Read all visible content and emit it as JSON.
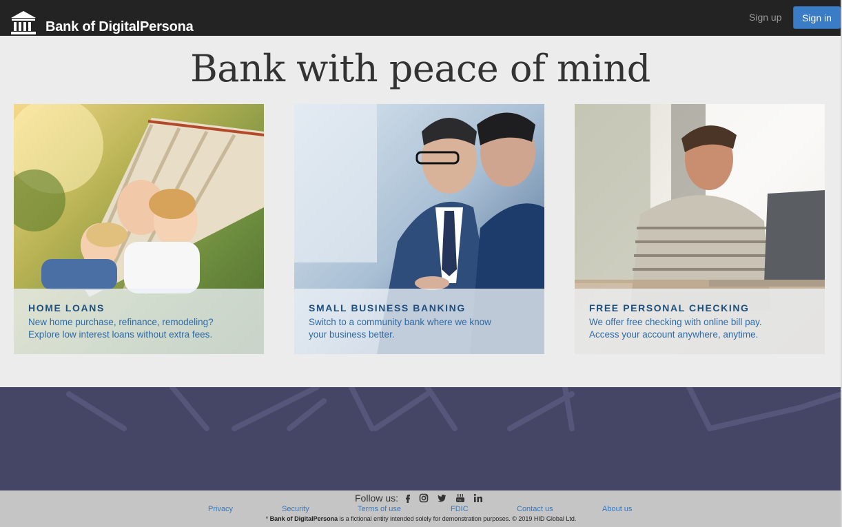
{
  "header": {
    "brand": "Bank of DigitalPersona",
    "signup_label": "Sign up",
    "signin_label": "Sign in"
  },
  "hero": {
    "title": "Bank with peace of mind"
  },
  "cards": [
    {
      "title": "HOME LOANS",
      "line1": "New home purchase, refinance, remodeling?",
      "line2": "Explore low interest loans without extra fees."
    },
    {
      "title": "SMALL BUSINESS BANKING",
      "line1": "Switch to a community bank where we know",
      "line2": "your business better."
    },
    {
      "title": "FREE PERSONAL CHECKING",
      "line1": "We offer free checking with online bill pay.",
      "line2": "Access your account anywhere, anytime."
    }
  ],
  "footer": {
    "follow_label": "Follow us:",
    "social_icons": [
      "facebook-icon",
      "instagram-icon",
      "twitter-icon",
      "youtube-icon",
      "linkedin-icon"
    ],
    "links": [
      "Privacy",
      "Security",
      "Terms of use",
      "FDIC",
      "Contact us",
      "About us"
    ],
    "disclaimer_prefix": "* ",
    "disclaimer_brand": "Bank of DigitalPersona",
    "disclaimer_text": " is a fictional entity intended solely for demonstration purposes. © 2019 HID Global Ltd."
  },
  "colors": {
    "header_bg": "#232323",
    "accent": "#3a7cc5",
    "banner_bg": "#454566",
    "footer_bg": "#c5c5c5",
    "card_title": "#1f4f7c",
    "card_text": "#2f6aa4"
  }
}
